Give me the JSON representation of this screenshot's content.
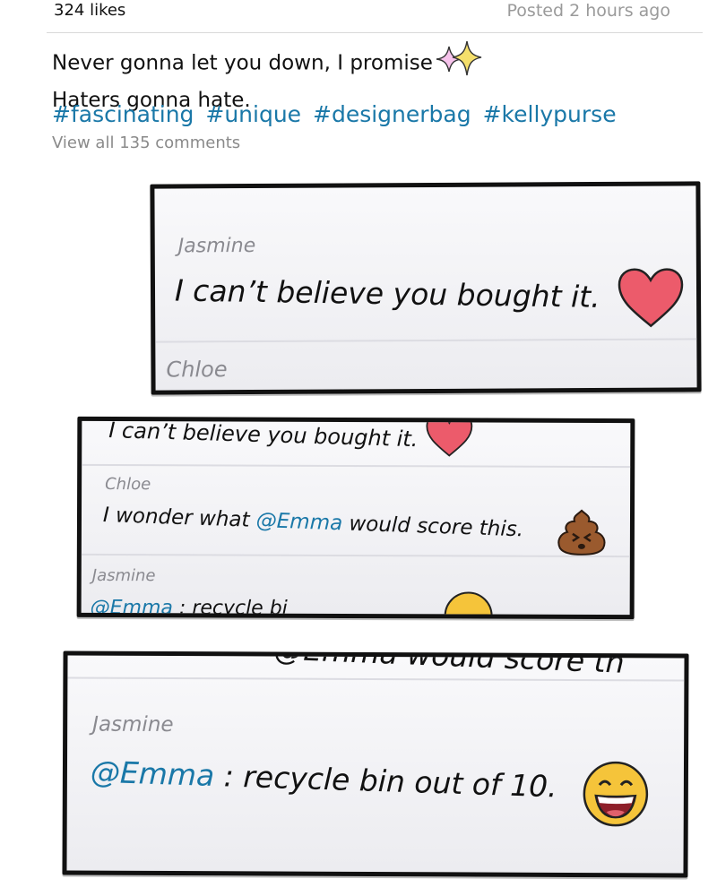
{
  "post": {
    "likes": "324 likes",
    "posted": "Posted 2 hours ago",
    "caption_line1": "Never gonna let you down, I promise",
    "caption_line2": "Haters gonna hate.",
    "hashtags": [
      "#fascinating",
      "#unique",
      "#designerbag",
      "#kellypurse"
    ],
    "view_comments": "View all 135 comments"
  },
  "panels": {
    "p1": {
      "name1": "Jasmine",
      "text1": "I can’t believe you bought it.",
      "name2": "Chloe"
    },
    "p2": {
      "text0": "I can’t believe you bought it.",
      "name1": "Chloe",
      "text1_pre": "I wonder what ",
      "text1_mention": "@Emma",
      "text1_post": " would score this.",
      "name2": "Jasmine",
      "text2_mention": "@Emma",
      "text2_post": " : recycle bi"
    },
    "p3": {
      "text0": "@Emma would score th",
      "name1": "Jasmine",
      "text1_mention": "@Emma",
      "text1_post": " : recycle bin out of 10."
    }
  },
  "colors": {
    "hashtag": "#1a78a8",
    "muted": "#8a8a8a",
    "heart": "#ec5b6b",
    "panel_border": "#111111"
  },
  "icons": [
    "sparkles-icon",
    "heart-emoji-icon",
    "poop-emoji-icon",
    "grinning-emoji-icon"
  ]
}
